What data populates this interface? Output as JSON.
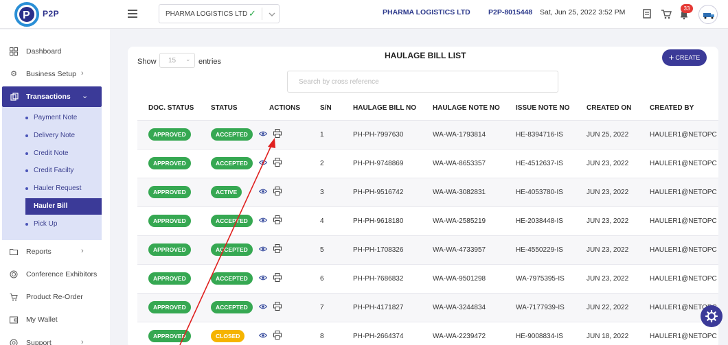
{
  "brand": {
    "name": "P2P"
  },
  "header": {
    "org_select_value": "PHARMA LOGISTICS LTD",
    "company_name": "PHARMA LOGISTICS LTD",
    "account_id": "P2P-8015448",
    "datetime": "Sat, Jun 25, 2022 3:52 PM",
    "notification_count": "33",
    "icons": [
      "menu-icon",
      "check-icon",
      "chevron-down-icon",
      "document-icon",
      "cart-icon",
      "bell-icon"
    ]
  },
  "sidebar": {
    "items": [
      {
        "label": "Dashboard",
        "icon": "grid-icon"
      },
      {
        "label": "Business Setup",
        "icon": "gear-icon",
        "arrow": "›"
      },
      {
        "label": "Transactions",
        "icon": "copy-icon",
        "arrow": "⌄"
      },
      {
        "label": "Reports",
        "icon": "folder-icon",
        "arrow": "›"
      },
      {
        "label": "Conference Exhibitors",
        "icon": "target-icon"
      },
      {
        "label": "Product Re-Order",
        "icon": "cart-icon"
      },
      {
        "label": "My Wallet",
        "icon": "wallet-icon"
      },
      {
        "label": "Support",
        "icon": "support-icon",
        "arrow": "›"
      }
    ],
    "submenu": [
      {
        "label": "Payment Note"
      },
      {
        "label": "Delivery Note"
      },
      {
        "label": "Credit Note"
      },
      {
        "label": "Credit Facilty"
      },
      {
        "label": "Hauler Request"
      },
      {
        "label": "Hauler Bill"
      },
      {
        "label": "Pick Up"
      }
    ]
  },
  "main": {
    "title": "HAULAGE BILL LIST",
    "create_label": "CREATE",
    "show_label": "Show",
    "entries_value": "15",
    "entries_label": "entries",
    "search_placeholder": "Search by cross reference",
    "columns": [
      "DOC. STATUS",
      "STATUS",
      "ACTIONS",
      "S/N",
      "HAULAGE BILL NO",
      "HAULAGE NOTE NO",
      "ISSUE NOTE NO",
      "CREATED ON",
      "CREATED BY"
    ],
    "rows": [
      {
        "doc_status": "APPROVED",
        "status": "ACCEPTED",
        "sn": "1",
        "bill_no": "PH-PH-7997630",
        "note_no": "WA-WA-1793814",
        "issue_no": "HE-8394716-IS",
        "created_on": "JUN 25, 2022",
        "created_by": "HAULER1@NETOPC"
      },
      {
        "doc_status": "APPROVED",
        "status": "ACCEPTED",
        "sn": "2",
        "bill_no": "PH-PH-9748869",
        "note_no": "WA-WA-8653357",
        "issue_no": "HE-4512637-IS",
        "created_on": "JUN 23, 2022",
        "created_by": "HAULER1@NETOPC"
      },
      {
        "doc_status": "APPROVED",
        "status": "ACTIVE",
        "sn": "3",
        "bill_no": "PH-PH-9516742",
        "note_no": "WA-WA-3082831",
        "issue_no": "HE-4053780-IS",
        "created_on": "JUN 23, 2022",
        "created_by": "HAULER1@NETOPC"
      },
      {
        "doc_status": "APPROVED",
        "status": "ACCEPTED",
        "sn": "4",
        "bill_no": "PH-PH-9618180",
        "note_no": "WA-WA-2585219",
        "issue_no": "HE-2038448-IS",
        "created_on": "JUN 23, 2022",
        "created_by": "HAULER1@NETOPC"
      },
      {
        "doc_status": "APPROVED",
        "status": "ACCEPTED",
        "sn": "5",
        "bill_no": "PH-PH-1708326",
        "note_no": "WA-WA-4733957",
        "issue_no": "HE-4550229-IS",
        "created_on": "JUN 23, 2022",
        "created_by": "HAULER1@NETOPC"
      },
      {
        "doc_status": "APPROVED",
        "status": "ACCEPTED",
        "sn": "6",
        "bill_no": "PH-PH-7686832",
        "note_no": "WA-WA-9501298",
        "issue_no": "WA-7975395-IS",
        "created_on": "JUN 23, 2022",
        "created_by": "HAULER1@NETOPC"
      },
      {
        "doc_status": "APPROVED",
        "status": "ACCEPTED",
        "sn": "7",
        "bill_no": "PH-PH-4171827",
        "note_no": "WA-WA-3244834",
        "issue_no": "WA-7177939-IS",
        "created_on": "JUN 22, 2022",
        "created_by": "HAULER1@NETOPC"
      },
      {
        "doc_status": "APPROVED",
        "status": "CLOSED",
        "sn": "8",
        "bill_no": "PH-PH-2664374",
        "note_no": "WA-WA-2239472",
        "issue_no": "HE-9008834-IS",
        "created_on": "JUN 18, 2022",
        "created_by": "HAULER1@NETOPC"
      }
    ]
  },
  "colors": {
    "brand": "#3b3a98",
    "approved": "#36a852",
    "closed": "#f5b400",
    "annotation_arrow": "#e0201f"
  }
}
